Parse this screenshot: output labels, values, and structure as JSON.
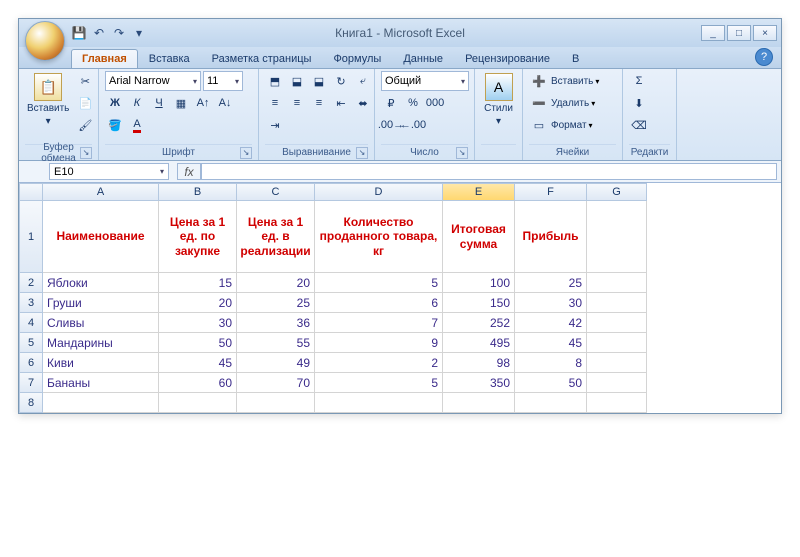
{
  "title": "Книга1 - Microsoft Excel",
  "qat": {
    "save": "💾",
    "undo": "↶",
    "redo": "↷"
  },
  "tabs": [
    "Главная",
    "Вставка",
    "Разметка страницы",
    "Формулы",
    "Данные",
    "Рецензирование",
    "В"
  ],
  "ribbon": {
    "clipboard": {
      "paste": "Вставить",
      "label": "Буфер обмена"
    },
    "font": {
      "name": "Arial Narrow",
      "size": "11",
      "label": "Шрифт",
      "bold": "Ж",
      "italic": "К",
      "underline": "Ч"
    },
    "align": {
      "label": "Выравнивание"
    },
    "number": {
      "format": "Общий",
      "label": "Число",
      "pct": "%",
      "comma": "000"
    },
    "styles": {
      "btn": "Стили"
    },
    "cells": {
      "insert": "Вставить",
      "delete": "Удалить",
      "format": "Формат",
      "label": "Ячейки"
    },
    "editing": {
      "label": "Редакти"
    }
  },
  "namebox": "E10",
  "fx": "fx",
  "cols": [
    "A",
    "B",
    "C",
    "D",
    "E",
    "F",
    "G"
  ],
  "headers": {
    "A": "Наименование",
    "B": "Цена за 1 ед. по закупке",
    "C": "Цена за 1 ед. в реализации",
    "D": "Количество проданного товара, кг",
    "E": "Итоговая сумма",
    "F": "Прибыль"
  },
  "rows": [
    {
      "n": "2",
      "A": "Яблоки",
      "B": "15",
      "C": "20",
      "D": "5",
      "E": "100",
      "F": "25"
    },
    {
      "n": "3",
      "A": "Груши",
      "B": "20",
      "C": "25",
      "D": "6",
      "E": "150",
      "F": "30"
    },
    {
      "n": "4",
      "A": "Сливы",
      "B": "30",
      "C": "36",
      "D": "7",
      "E": "252",
      "F": "42"
    },
    {
      "n": "5",
      "A": "Мандарины",
      "B": "50",
      "C": "55",
      "D": "9",
      "E": "495",
      "F": "45"
    },
    {
      "n": "6",
      "A": "Киви",
      "B": "45",
      "C": "49",
      "D": "2",
      "E": "98",
      "F": "8"
    },
    {
      "n": "7",
      "A": "Бананы",
      "B": "60",
      "C": "70",
      "D": "5",
      "E": "350",
      "F": "50"
    }
  ],
  "active_cell": "E10"
}
